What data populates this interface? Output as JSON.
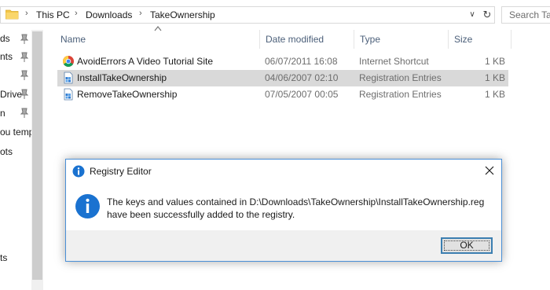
{
  "address": {
    "breadcrumbs": [
      "This PC",
      "Downloads",
      "TakeOwnership"
    ],
    "search_placeholder": "Search Ta"
  },
  "nav": {
    "items": [
      {
        "label": "ds",
        "pinned": true
      },
      {
        "label": "nts",
        "pinned": true
      },
      {
        "label": "",
        "pinned": true
      },
      {
        "label": "Drive",
        "pinned": true
      },
      {
        "label": "n",
        "pinned": true
      },
      {
        "label": "ou temp",
        "pinned": false
      },
      {
        "label": "ots",
        "pinned": false
      },
      {
        "label": "ts",
        "pinned": false
      }
    ]
  },
  "list": {
    "headers": {
      "name": "Name",
      "date": "Date modified",
      "type": "Type",
      "size": "Size"
    },
    "rows": [
      {
        "name": "AvoidErrors  A Video Tutorial Site",
        "date": "06/07/2011 16:08",
        "type": "Internet Shortcut",
        "size": "1 KB",
        "icon": "chrome-shortcut-icon",
        "selected": false
      },
      {
        "name": "InstallTakeOwnership",
        "date": "04/06/2007 02:10",
        "type": "Registration Entries",
        "size": "1 KB",
        "icon": "registry-file-icon",
        "selected": true
      },
      {
        "name": "RemoveTakeOwnership",
        "date": "07/05/2007 00:05",
        "type": "Registration Entries",
        "size": "1 KB",
        "icon": "registry-file-icon",
        "selected": false
      }
    ]
  },
  "dialog": {
    "title": "Registry Editor",
    "message_line1": "The keys and values contained in D:\\Downloads\\TakeOwnership\\InstallTakeOwnership.reg",
    "message_line2": "have been successfully added to the registry.",
    "ok_label": "OK"
  },
  "colors": {
    "selection": "#d9d9d9",
    "header_text": "#4c607a",
    "dialog_border": "#4a8fd6",
    "info_icon": "#1a72d0",
    "footer": "#f0f0f0"
  }
}
